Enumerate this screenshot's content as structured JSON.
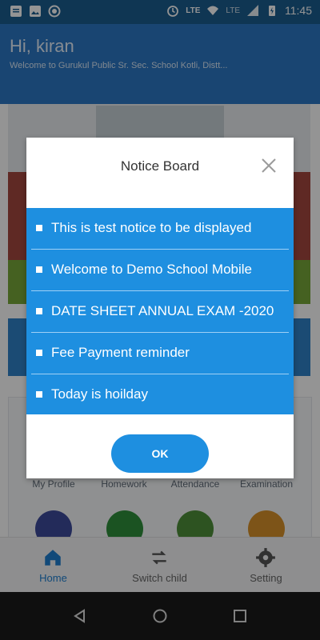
{
  "status_bar": {
    "time": "11:45",
    "network_label_1": "LTE",
    "network_label_2": "LTE",
    "left_icons": [
      "notification-icon",
      "image-icon",
      "sync-icon"
    ],
    "right_icons": [
      "alarm-icon",
      "phone-lte-icon",
      "wifi-icon",
      "signal-icon",
      "battery-charging-icon"
    ]
  },
  "header": {
    "greeting": "Hi, kiran",
    "welcome_text": "Welcome to Gurukul Public Sr. Sec. School Kotli, Distt..."
  },
  "grid": {
    "labels": [
      "My Profile",
      "Homework",
      "Attendance",
      "Examination"
    ]
  },
  "bottom_nav": {
    "items": [
      {
        "label": "Home",
        "icon": "home-icon",
        "active": true
      },
      {
        "label": "Switch child",
        "icon": "switch-icon",
        "active": false
      },
      {
        "label": "Setting",
        "icon": "gear-icon",
        "active": false
      }
    ]
  },
  "dialog": {
    "title": "Notice Board",
    "close_icon": "close-icon",
    "notices": [
      "This is test notice to be displayed",
      "Welcome to Demo School Mobile",
      "DATE SHEET ANNUAL EXAM -2020",
      "Fee Payment reminder",
      "Today is hoilday"
    ],
    "ok_label": "OK"
  },
  "colors": {
    "header_blue": "#2b78c5",
    "dialog_list_blue": "#1e8fe0",
    "nav_active": "#1e7fd0"
  }
}
